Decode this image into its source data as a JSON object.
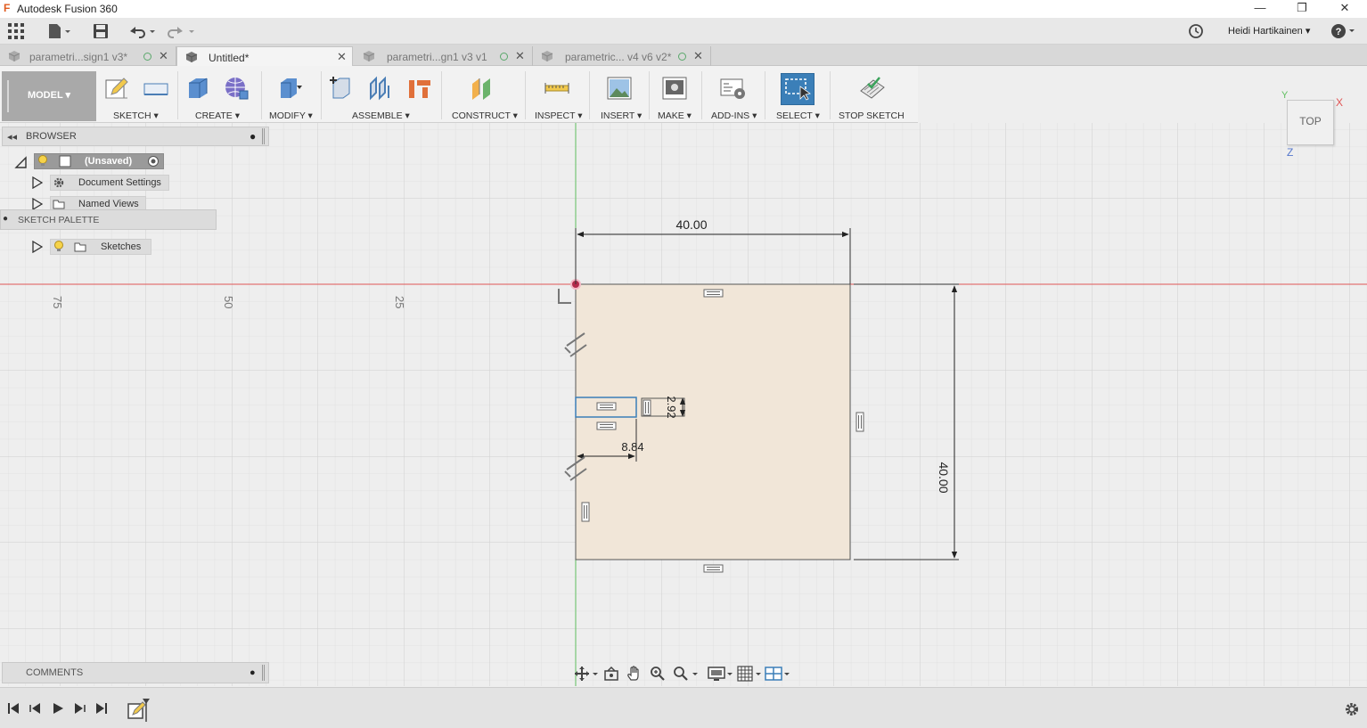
{
  "window": {
    "title": "Autodesk Fusion 360",
    "logo_letter": "F",
    "minimize": "—",
    "restore": "❐",
    "close": "✕"
  },
  "quickbar": {
    "user_name": "Heidi Hartikainen ▾",
    "help": "?"
  },
  "tabs": [
    {
      "label": "parametri...sign1 v3*",
      "active": false
    },
    {
      "label": "Untitled*",
      "active": true
    },
    {
      "label": "parametri...gn1 v3 v1",
      "active": false
    },
    {
      "label": "parametric... v4 v6 v2*",
      "active": false
    }
  ],
  "toolbar": {
    "workspace": "MODEL ▾",
    "groups": [
      {
        "label": "SKETCH ▾"
      },
      {
        "label": "CREATE ▾"
      },
      {
        "label": "MODIFY ▾"
      },
      {
        "label": "ASSEMBLE ▾"
      },
      {
        "label": "CONSTRUCT ▾"
      },
      {
        "label": "INSPECT ▾"
      },
      {
        "label": "INSERT ▾"
      },
      {
        "label": "MAKE ▾"
      },
      {
        "label": "ADD-INS ▾"
      },
      {
        "label": "SELECT ▾"
      },
      {
        "label": "STOP SKETCH"
      }
    ]
  },
  "browser": {
    "title": "BROWSER",
    "root": "(Unsaved)",
    "items": [
      {
        "label": "Document Settings"
      },
      {
        "label": "Named Views"
      },
      {
        "label": "Sketches"
      }
    ]
  },
  "sketch_palette": "SKETCH PALETTE",
  "comments": "COMMENTS",
  "viewcube": {
    "face": "TOP",
    "axis_x": "X",
    "axis_y": "Y",
    "axis_z": "Z"
  },
  "canvas": {
    "ruler_labels": [
      "75",
      "50",
      "25"
    ],
    "dim_width": "40.00",
    "dim_height": "40.00",
    "dim_small_h": "2.92",
    "dim_small_w": "8.84"
  },
  "colors": {
    "accent": "#3b7fb8",
    "x_axis": "#e05555",
    "y_axis": "#5fbf5f",
    "profile_fill": "#f1e6d8"
  }
}
